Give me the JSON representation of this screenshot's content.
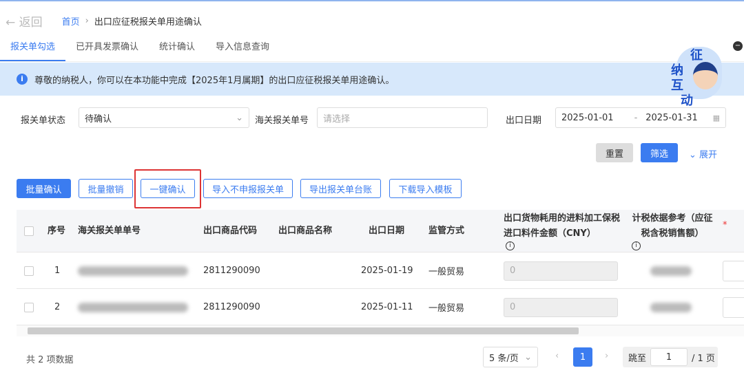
{
  "header": {
    "back_label": "返回",
    "breadcrumb_home": "首页",
    "breadcrumb_sep": "›",
    "breadcrumb_current": "出口应征税报关单用途确认"
  },
  "tabs": [
    {
      "label": "报关单勾选",
      "active": true
    },
    {
      "label": "已开具发票确认"
    },
    {
      "label": "统计确认"
    },
    {
      "label": "导入信息查询"
    }
  ],
  "notice": {
    "icon": "info-icon",
    "text": "尊敬的纳税人，你可以在本功能中完成【2025年1月属期】的出口应征税报关单用途确认。"
  },
  "mascot": {
    "text": "征纳互动"
  },
  "filters": {
    "status_label": "报关单状态",
    "status_value": "待确认",
    "customs_no_label": "海关报关单号",
    "customs_no_placeholder": "请选择",
    "date_label": "出口日期",
    "date_start": "2025-01-01",
    "date_sep": "-",
    "date_end": "2025-01-31"
  },
  "filter_actions": {
    "reset": "重置",
    "filter": "筛选",
    "expand": "展开"
  },
  "toolbar": {
    "batch_confirm": "批量确认",
    "batch_revoke": "批量撤销",
    "one_click_confirm": "一键确认",
    "import_non_declare": "导入不申报报关单",
    "export_ledger": "导出报关单台账",
    "download_template": "下载导入模板"
  },
  "table": {
    "headers": {
      "index": "序号",
      "customs_no": "海关报关单单号",
      "goods_code": "出口商品代码",
      "goods_name": "出口商品名称",
      "export_date": "出口日期",
      "supervision": "监管方式",
      "material_amount": "出口货物耗用的进料加工保税进口料件金额（CNY）",
      "tax_basis": "计税依据参考（应征税含税销售额）",
      "required_mark": "*"
    },
    "rows": [
      {
        "index": "1",
        "goods_code": "2811290090",
        "goods_name": "",
        "export_date": "2025-01-19",
        "supervision": "一般贸易",
        "material_amount": "0"
      },
      {
        "index": "2",
        "goods_code": "2811290090",
        "goods_name": "",
        "export_date": "2025-01-11",
        "supervision": "一般贸易",
        "material_amount": "0"
      }
    ]
  },
  "pagination": {
    "total": "共 2 项数据",
    "page_size": "5 条/页",
    "current_page": "1",
    "jump_label": "跳至",
    "jump_value": "1",
    "total_pages": "/ 1 页"
  },
  "colors": {
    "accent": "#3b7cf0",
    "highlight_box": "#d33333",
    "notice_bg": "#d7e8fb"
  }
}
